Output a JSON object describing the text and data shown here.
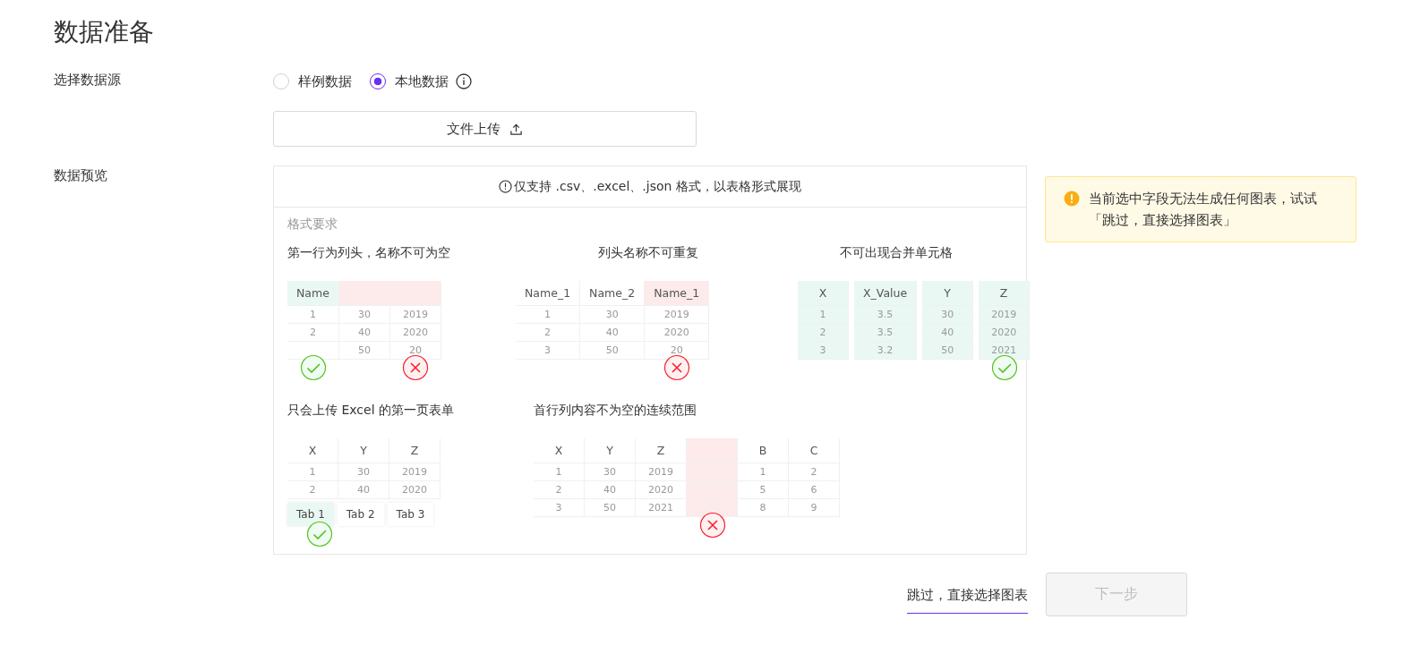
{
  "page_title": "数据准备",
  "source": {
    "label": "选择数据源",
    "options": [
      {
        "label": "样例数据",
        "selected": false,
        "info": false
      },
      {
        "label": "本地数据",
        "selected": true,
        "info": true
      }
    ]
  },
  "upload_button": "文件上传",
  "preview": {
    "label": "数据预览",
    "notice": "仅支持 .csv、.excel、.json 格式，以表格形式展现",
    "section_title": "格式要求",
    "examples": [
      {
        "title": "第一行为列头，名称不可为空",
        "columns": [
          {
            "header": "Name",
            "cells": [
              "1",
              "2",
              null
            ],
            "highlighted": true,
            "whole_column": false,
            "valid": true,
            "marked": true
          },
          {
            "cells": [
              "30",
              "40",
              "50"
            ],
            "highlighted": true,
            "whole_column": false,
            "valid": false
          },
          {
            "cells": [
              "2019",
              "2020",
              "20"
            ],
            "highlighted": true,
            "whole_column": false,
            "valid": false,
            "marked": true
          }
        ]
      },
      {
        "title": "列头名称不可重复",
        "columns": [
          {
            "header": "Name_1",
            "cells": [
              "1",
              "2",
              "3"
            ],
            "highlighted": false
          },
          {
            "header": "Name_2",
            "cells": [
              "30",
              "40",
              "50"
            ],
            "highlighted": false
          },
          {
            "header": "Name_1",
            "cells": [
              "2019",
              "2020",
              "20"
            ],
            "highlighted": true,
            "whole_column": false,
            "valid": false,
            "marked": true
          }
        ]
      },
      {
        "title": "不可出现合并单元格",
        "columns": [
          {
            "header": "X",
            "cells": [
              "1",
              "2",
              "3"
            ],
            "highlighted": true,
            "whole_column": true,
            "valid": true
          },
          {
            "header": "X_Value",
            "cells": [
              "3.5",
              "3.5",
              "3.2"
            ],
            "highlighted": true,
            "whole_column": true,
            "valid": true
          },
          {
            "header": "Y",
            "cells": [
              "30",
              "40",
              "50"
            ],
            "highlighted": true,
            "whole_column": true,
            "valid": true
          },
          {
            "header": "Z",
            "cells": [
              "2019",
              "2020",
              "2021"
            ],
            "highlighted": true,
            "whole_column": true,
            "valid": true,
            "marked": true
          }
        ]
      },
      {
        "title": "只会上传 Excel 的第一页表单",
        "columns": [
          {
            "header": "X",
            "cells": [
              "1",
              "2"
            ],
            "highlighted": false
          },
          {
            "header": "Y",
            "cells": [
              "30",
              "40"
            ],
            "highlighted": false
          },
          {
            "header": "Z",
            "cells": [
              "2019",
              "2020"
            ],
            "highlighted": false
          }
        ],
        "tabs": [
          {
            "label": "Tab 1",
            "selected": true,
            "marked": true
          },
          {
            "label": "Tab 2",
            "selected": false
          },
          {
            "label": "Tab 3",
            "selected": false
          }
        ]
      },
      {
        "title": "首行列内容不为空的连续范围",
        "columns": [
          {
            "header": "X",
            "cells": [
              "1",
              "2",
              "3"
            ],
            "highlighted": false
          },
          {
            "header": "Y",
            "cells": [
              "30",
              "40",
              "50"
            ],
            "highlighted": false
          },
          {
            "header": "Z",
            "cells": [
              "2019",
              "2020",
              "2021"
            ],
            "highlighted": false
          },
          {
            "highlighted": true,
            "whole_column": true,
            "valid": false,
            "marked": true
          },
          {
            "header": "B",
            "cells": [
              "1",
              "5",
              "8"
            ],
            "highlighted": false
          },
          {
            "header": "C",
            "cells": [
              "2",
              "6",
              "9"
            ],
            "highlighted": false
          }
        ]
      }
    ]
  },
  "alert": "当前选中字段无法生成任何图表，试试「跳过，直接选择图表」",
  "actions": {
    "skip": "跳过，直接选择图表",
    "next": {
      "label": "下一步",
      "disabled": true
    }
  }
}
